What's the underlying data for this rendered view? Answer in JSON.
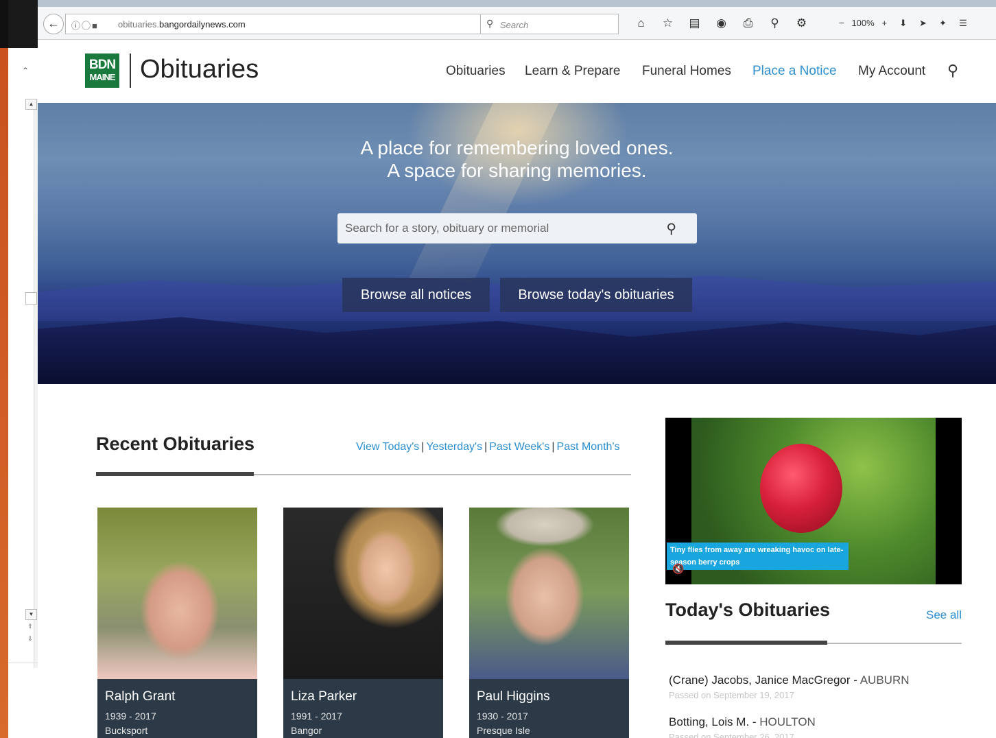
{
  "browser": {
    "url_prefix": "obituaries.",
    "url_domain": "bangordailynews.com",
    "search_placeholder": "Search",
    "zoom": "100%",
    "toolbar_icons": [
      "home-icon",
      "bookmark-star-icon",
      "reading-list-icon",
      "pocket-icon",
      "print-icon",
      "find-icon",
      "settings-icon"
    ]
  },
  "site": {
    "logo_line1": "BDN",
    "logo_line2": "MAINE",
    "title": "Obituaries",
    "nav": [
      {
        "label": "Obituaries"
      },
      {
        "label": "Learn & Prepare"
      },
      {
        "label": "Funeral Homes"
      },
      {
        "label": "Place a Notice"
      },
      {
        "label": "My Account"
      }
    ],
    "active_color": "#2d8fd0"
  },
  "hero": {
    "line1": "A place for remembering loved ones.",
    "line2": "A space for sharing memories.",
    "search_placeholder": "Search for a story, obituary or memorial",
    "btn_all": "Browse all notices",
    "btn_today": "Browse today's obituaries"
  },
  "recent": {
    "title": "Recent Obituaries",
    "links": [
      "View Today's",
      "Yesterday's",
      "Past Week's",
      "Past Month's"
    ],
    "cards": [
      {
        "name": "Ralph Grant",
        "years": "1939 - 2017",
        "town": "Bucksport"
      },
      {
        "name": "Liza Parker",
        "years": "1991 - 2017",
        "town": "Bangor"
      },
      {
        "name": "Paul Higgins",
        "years": "1930 - 2017",
        "town": "Presque Isle"
      }
    ]
  },
  "video": {
    "caption": "Tiny flies from away are wreaking havoc on late-season berry crops"
  },
  "today": {
    "title": "Today's Obituaries",
    "see_all": "See all",
    "items": [
      {
        "name": "(Crane) Jacobs, Janice MacGregor",
        "town": "AUBURN",
        "date": "Passed on September 19, 2017"
      },
      {
        "name": "Botting, Lois M.",
        "town": "HOULTON",
        "date": "Passed on September 26, 2017"
      }
    ]
  }
}
